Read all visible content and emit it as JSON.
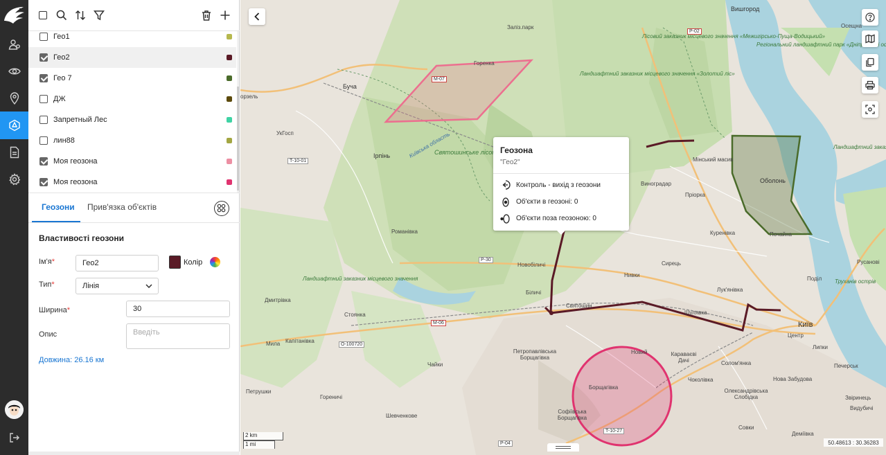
{
  "colors": {
    "rail_bg": "#2c2c2c",
    "rail_active": "#2196f3",
    "accent": "#1976d2",
    "geozone_line": "#5a1a26",
    "geozone_pink": "#ec6f8f",
    "geozone_green": "#4a6b2a",
    "geozone_magenta": "#e0336f"
  },
  "rail": {
    "items": [
      {
        "icon": "users-icon"
      },
      {
        "icon": "eye-icon"
      },
      {
        "icon": "location-pin-icon"
      },
      {
        "icon": "geozone-icon",
        "active": true
      },
      {
        "icon": "document-icon"
      },
      {
        "icon": "settings-icon"
      }
    ],
    "bottom": [
      {
        "icon": "avatar"
      },
      {
        "icon": "logout-icon"
      }
    ]
  },
  "toolbar": {
    "icons": [
      "select-all-checkbox",
      "search-icon",
      "sort-icon",
      "filter-icon",
      "delete-icon",
      "add-icon"
    ]
  },
  "geozones": [
    {
      "name": "Гео1",
      "checked": false,
      "color": "#b6b84e"
    },
    {
      "name": "Гео2",
      "checked": true,
      "color": "#5a1a26",
      "selected": true
    },
    {
      "name": "Гео 7",
      "checked": true,
      "color": "#4a6b2a"
    },
    {
      "name": "ДЖ",
      "checked": false,
      "color": "#5c4a0c"
    },
    {
      "name": "Запретный Лес",
      "checked": false,
      "color": "#3fd3a4"
    },
    {
      "name": "лин88",
      "checked": false,
      "color": "#a3a642"
    },
    {
      "name": "Моя геозона",
      "checked": true,
      "color": "#ec8fa3"
    },
    {
      "name": "Моя геозона",
      "checked": true,
      "color": "#e0336f"
    }
  ],
  "tabs": {
    "geozones": "Геозони",
    "binding": "Прив'язка об'єктів"
  },
  "form": {
    "title": "Властивості геозони",
    "name_label": "Ім'я",
    "name_value": "Гео2",
    "color_label": "Колір",
    "color_value": "#5a1a26",
    "type_label": "Тип",
    "type_value": "Лінія",
    "width_label": "Ширина",
    "width_value": "30",
    "desc_label": "Опис",
    "desc_placeholder": "Введіть",
    "length_text": "Довжина: 26.16 км",
    "required_mark": "*"
  },
  "map": {
    "back_icon": "chevron-left-icon",
    "right_buttons": [
      "help-icon",
      "map-layers-icon",
      "copy-icon",
      "print-icon",
      "locate-icon"
    ],
    "popup": {
      "title": "Геозона",
      "subtitle": "\"Гео2\"",
      "rows": [
        {
          "icon": "exit-control-icon",
          "text": "Контроль - вихід з геозони"
        },
        {
          "icon": "inside-icon",
          "text": "Об'єкти в геозоні: 0"
        },
        {
          "icon": "outside-icon",
          "text": "Об'єкти поза геозоною: 0"
        }
      ]
    },
    "scale": {
      "km": "2 km",
      "mi": "1 mi"
    },
    "coords": "50.48613 : 30.36283",
    "labels": {
      "vyshhorod": "Вишгород",
      "osescha": "Осещна",
      "bucha": "Буча",
      "irpin": "Ірпінь",
      "vorzel": "орзель",
      "ugosp": "УкГосп",
      "romanivka": "Романівка",
      "dmytrivka": "Дмитрівка",
      "stoyanka": "Стоянка",
      "myla": "Мила",
      "kapitanivka": "Капітанівка",
      "chaiky": "Чайки",
      "horenychi": "Гореничі",
      "petrushky": "Петрушки",
      "shevchenkove": "Шевченкове",
      "vynohradar": "Виноградар",
      "priorka": "Пріорка",
      "minskyi": "Мінський масив",
      "obolon": "Оболонь",
      "kurenivka": "Куренівка",
      "pochaina": "Почайна",
      "syrets": "Сирець",
      "lukianivka": "Лук'янівка",
      "podil": "Поділ",
      "kyiv": "Київ",
      "tsentr": "Центр",
      "lypky": "Липки",
      "novobilychi": "Новобіличі",
      "nyvky": "Нивки",
      "bilychi": "Біличі",
      "sviatoshyn": "Святошин",
      "shuliavka": "Шулявка",
      "karavaievi": "Караваєві Дачі",
      "solomianka": "Солом'янка",
      "chokolivka": "Чоколівка",
      "nova_zabudova": "Нова Забудова",
      "pecherska": "Печерськ",
      "oleksandrivska": "Олександрівська Слобідка",
      "zvirynets": "Звіринець",
      "sovky": "Совки",
      "demiivka": "Деміївка",
      "vydubychi": "Видубичі",
      "petropavlivska": "Петропавлівська Борщагівка",
      "sofiivska": "Софіївська Борщагівка",
      "borshchahivka": "Борщагівка",
      "novyi": "Новий",
      "rusanivka": "Русанові",
      "trukhaniv": "Труханів острів",
      "sviatoshyn_forest": "Святошинське лісопарк",
      "zoloti": "Ландшафтний заказник місцевого значення «Золотий ліс»",
      "mezhyhirsko": "Лісовий заказник місцевого значення «Межигірсько-Пуща-Водицький»",
      "irpin_zakaznyk": "Ландшафтний заказник місцевого значення",
      "dniprovsky": "Регіональний ландшафтний парк «Дніпровські острови»",
      "trukhaniv_zakaznyk": "Ландшафтний заказник місцевого значення «Лісовий зеленець»",
      "kyivska_oblast": "Київська область"
    },
    "roads": {
      "p02": "P-02",
      "m07": "M-07",
      "t1001": "T-10-01",
      "p30": "P-30",
      "m06": "M-06",
      "o100720": "O-100720",
      "t1027": "T-10-27",
      "p04": "P-04",
      "horenka": "Горенка",
      "bucha_zaliz": "Заліз.парк"
    }
  }
}
